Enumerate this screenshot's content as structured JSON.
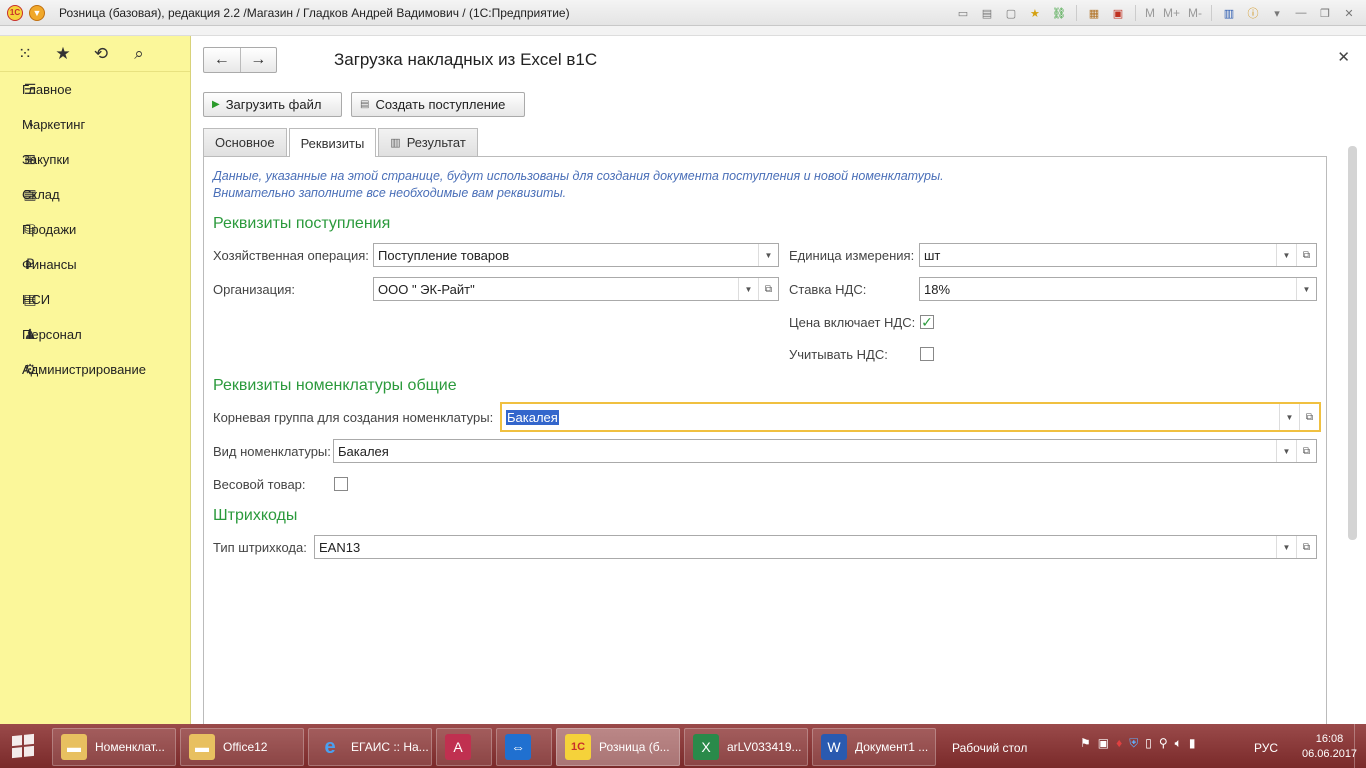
{
  "window": {
    "title": "Розница (базовая), редакция 2.2 /Магазин / Гладков Андрей Вадимович /  (1С:Предприятие)",
    "logo_text": "1С",
    "right_tools": [
      "M",
      "M+",
      "M-"
    ]
  },
  "sidebar": {
    "items": [
      {
        "label": "Главное",
        "icon": "menu-lines-icon"
      },
      {
        "label": "Маркетинг",
        "icon": "pie-chart-icon"
      },
      {
        "label": "Закупки",
        "icon": "purchase-icon"
      },
      {
        "label": "Склад",
        "icon": "warehouse-icon"
      },
      {
        "label": "Продажи",
        "icon": "basket-icon"
      },
      {
        "label": "Финансы",
        "icon": "ruble-icon"
      },
      {
        "label": "НСИ",
        "icon": "catalog-icon"
      },
      {
        "label": "Персонал",
        "icon": "person-icon"
      },
      {
        "label": "Администрирование",
        "icon": "gear-icon"
      }
    ]
  },
  "form": {
    "title": "Загрузка накладных из Excel в1С",
    "load_button": "Загрузить файл",
    "create_button": "Создать поступление",
    "tabs": [
      "Основное",
      "Реквизиты",
      "Результат"
    ],
    "hint_line1": "Данные, указанные на этой странице, будут использованы для создания документа поступления и новой номенклатуры.",
    "hint_line2": "Внимательно заполните все необходимые вам реквизиты.",
    "section1": "Реквизиты поступления",
    "operation_label": "Хозяйственная операция:",
    "operation_value": "Поступление товаров",
    "org_label": "Организация:",
    "org_value": "ООО \" ЭК-Райт\"",
    "unit_label": "Единица измерения:",
    "unit_value": "шт",
    "vat_rate_label": "Ставка НДС:",
    "vat_rate_value": "18%",
    "price_incl_vat_label": "Цена включает НДС:",
    "price_incl_vat_checked": true,
    "account_vat_label": "Учитывать НДС:",
    "account_vat_checked": false,
    "section2": "Реквизиты номенклатуры общие",
    "root_group_label": "Корневая группа для создания номенклатуры:",
    "root_group_value": "Бакалея",
    "nom_type_label": "Вид номенклатуры:",
    "nom_type_value": "Бакалея",
    "weight_label": "Весовой товар:",
    "weight_checked": false,
    "section3": "Штрихкоды",
    "barcode_label": "Тип штрихкода:",
    "barcode_value": "EAN13"
  },
  "taskbar": {
    "tasks": [
      {
        "label": "Номенклат...",
        "icon": "folder-icon"
      },
      {
        "label": "Office12",
        "icon": "folder-icon"
      },
      {
        "label": "ЕГАИС :: На...",
        "icon": "ie-icon"
      },
      {
        "label": "",
        "icon": "access-icon"
      },
      {
        "label": "",
        "icon": "teamviewer-icon"
      },
      {
        "label": "Розница (б...",
        "icon": "1c-icon"
      },
      {
        "label": "arLV033419...",
        "icon": "excel-icon"
      },
      {
        "label": "Документ1 ...",
        "icon": "word-icon"
      }
    ],
    "desktop_label": "Рабочий стол",
    "lang": "РУС",
    "time": "16:08",
    "date": "06.06.2017"
  },
  "colors": {
    "sidebar_bg": "#fbf79a",
    "section_green": "#2b9a3c",
    "hint_blue": "#4a6fb8",
    "focus_border": "#f0c040",
    "taskbar": "#8a3a3a"
  }
}
